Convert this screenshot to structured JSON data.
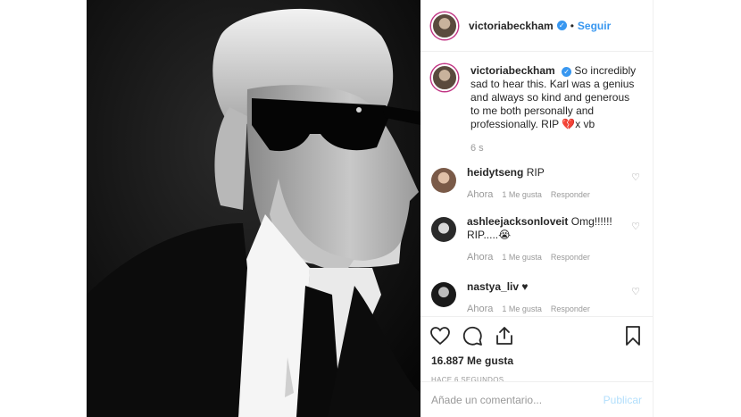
{
  "header": {
    "username": "victoriabeckham",
    "dot": "•",
    "follow_label": "Seguir"
  },
  "caption": {
    "username": "victoriabeckham",
    "text": "So incredibly sad to hear this. Karl was a genius and always so kind and generous to me both personally and professionally. RIP 💔x vb",
    "time": "6 s"
  },
  "comments": [
    {
      "username": "heidytseng",
      "text": "RIP",
      "time": "Ahora",
      "likes": "1 Me gusta",
      "reply": "Responder"
    },
    {
      "username": "ashleejacksonloveit",
      "text": "Omg!!!!!! RIP.....😭",
      "time": "Ahora",
      "likes": "1 Me gusta",
      "reply": "Responder"
    },
    {
      "username": "nastya_liv",
      "text": "♥",
      "time": "Ahora",
      "likes": "1 Me gusta",
      "reply": "Responder"
    }
  ],
  "icons": {
    "like": "heart-icon",
    "comment": "comment-bubble-icon",
    "share": "share-icon",
    "save": "bookmark-icon",
    "comment_like": "small-heart-icon"
  },
  "stats": {
    "likes": "16.887 Me gusta",
    "posted": "HACE 6 SEGUNDOS"
  },
  "add_comment": {
    "placeholder": "Añade un comentario...",
    "publish_label": "Publicar"
  },
  "colors": {
    "link_blue": "#3897f0",
    "muted_gray": "#999999",
    "publish_disabled": "#b2dffc",
    "story_ring": "#c13584"
  }
}
